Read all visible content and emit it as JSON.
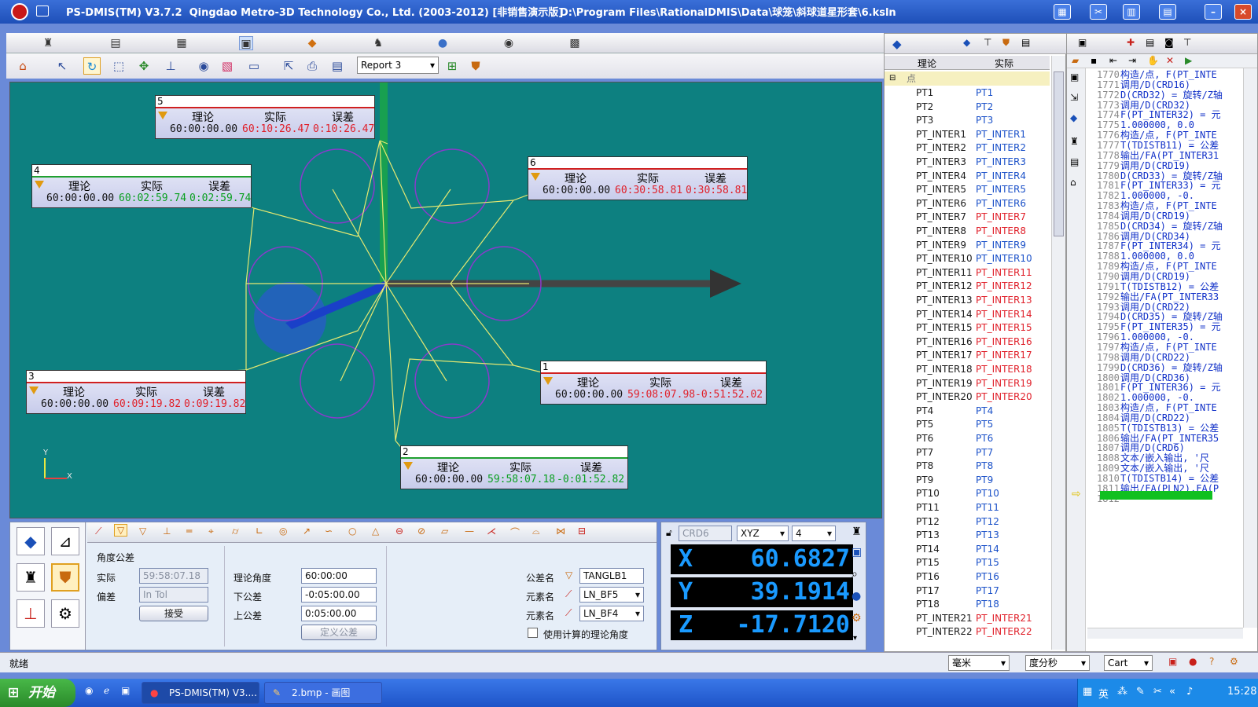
{
  "titlebar": {
    "app": "PS-DMIS(TM) V3.7.2",
    "company": "Qingdao Metro-3D Technology Co., Ltd. (2003-2012) [非销售演示版]",
    "path": "D:\\Program Files\\RationalDMIS\\Data\\球笼\\斜球道星形套\\6.ksln"
  },
  "toolbar": {
    "report": "Report 3"
  },
  "boxes": [
    {
      "id": "5",
      "h": [
        "理论",
        "实际",
        "误差"
      ],
      "theo": "60:00:00.00",
      "act": "60:10:26.47",
      "err": "0:10:26.47",
      "color": "red"
    },
    {
      "id": "4",
      "h": [
        "理论",
        "实际",
        "误差"
      ],
      "theo": "60:00:00.00",
      "act": "60:02:59.74",
      "err": "0:02:59.74",
      "color": "green"
    },
    {
      "id": "6",
      "h": [
        "理论",
        "实际",
        "误差"
      ],
      "theo": "60:00:00.00",
      "act": "60:30:58.81",
      "err": "0:30:58.81",
      "color": "red"
    },
    {
      "id": "1",
      "h": [
        "理论",
        "实际",
        "误差"
      ],
      "theo": "60:00:00.00",
      "act": "59:08:07.98",
      "err": "-0:51:52.02",
      "color": "red"
    },
    {
      "id": "3",
      "h": [
        "理论",
        "实际",
        "误差"
      ],
      "theo": "60:00:00.00",
      "act": "60:09:19.82",
      "err": "0:09:19.82",
      "color": "red"
    },
    {
      "id": "2",
      "h": [
        "理论",
        "实际",
        "误差"
      ],
      "theo": "60:00:00.00",
      "act": "59:58:07.18",
      "err": "-0:01:52.82",
      "color": "green"
    }
  ],
  "axes": {
    "y": "Y",
    "x": "X"
  },
  "tree": {
    "col1": "理论",
    "col2": "实际",
    "root": "点",
    "rows": [
      [
        "PT1",
        "PT1",
        "b"
      ],
      [
        "PT2",
        "PT2",
        "b"
      ],
      [
        "PT3",
        "PT3",
        "b"
      ],
      [
        "PT_INTER1",
        "PT_INTER1",
        "b"
      ],
      [
        "PT_INTER2",
        "PT_INTER2",
        "b"
      ],
      [
        "PT_INTER3",
        "PT_INTER3",
        "b"
      ],
      [
        "PT_INTER4",
        "PT_INTER4",
        "b"
      ],
      [
        "PT_INTER5",
        "PT_INTER5",
        "b"
      ],
      [
        "PT_INTER6",
        "PT_INTER6",
        "b"
      ],
      [
        "PT_INTER7",
        "PT_INTER7",
        "r"
      ],
      [
        "PT_INTER8",
        "PT_INTER8",
        "r"
      ],
      [
        "PT_INTER9",
        "PT_INTER9",
        "b"
      ],
      [
        "PT_INTER10",
        "PT_INTER10",
        "b"
      ],
      [
        "PT_INTER11",
        "PT_INTER11",
        "r"
      ],
      [
        "PT_INTER12",
        "PT_INTER12",
        "r"
      ],
      [
        "PT_INTER13",
        "PT_INTER13",
        "r"
      ],
      [
        "PT_INTER14",
        "PT_INTER14",
        "r"
      ],
      [
        "PT_INTER15",
        "PT_INTER15",
        "r"
      ],
      [
        "PT_INTER16",
        "PT_INTER16",
        "r"
      ],
      [
        "PT_INTER17",
        "PT_INTER17",
        "r"
      ],
      [
        "PT_INTER18",
        "PT_INTER18",
        "r"
      ],
      [
        "PT_INTER19",
        "PT_INTER19",
        "r"
      ],
      [
        "PT_INTER20",
        "PT_INTER20",
        "r"
      ],
      [
        "PT4",
        "PT4",
        "b"
      ],
      [
        "PT5",
        "PT5",
        "b"
      ],
      [
        "PT6",
        "PT6",
        "b"
      ],
      [
        "PT7",
        "PT7",
        "b"
      ],
      [
        "PT8",
        "PT8",
        "b"
      ],
      [
        "PT9",
        "PT9",
        "b"
      ],
      [
        "PT10",
        "PT10",
        "b"
      ],
      [
        "PT11",
        "PT11",
        "b"
      ],
      [
        "PT12",
        "PT12",
        "b"
      ],
      [
        "PT13",
        "PT13",
        "b"
      ],
      [
        "PT14",
        "PT14",
        "b"
      ],
      [
        "PT15",
        "PT15",
        "b"
      ],
      [
        "PT16",
        "PT16",
        "b"
      ],
      [
        "PT17",
        "PT17",
        "b"
      ],
      [
        "PT18",
        "PT18",
        "b"
      ],
      [
        "PT_INTER21",
        "PT_INTER21",
        "r"
      ],
      [
        "PT_INTER22",
        "PT_INTER22",
        "r"
      ]
    ]
  },
  "code": [
    [
      "1770",
      "构造/点, F(PT_INTE"
    ],
    [
      "1771",
      "调用/D(CRD16)"
    ],
    [
      "1772",
      "D(CRD32) = 旋转/Z轴"
    ],
    [
      "1773",
      "调用/D(CRD32)"
    ],
    [
      "1774",
      "F(PT_INTER32) = 元"
    ],
    [
      "1775",
      "    1.000000, 0.0"
    ],
    [
      "1776",
      "构造/点, F(PT_INTE"
    ],
    [
      "1777",
      "T(TDISTB11) = 公差"
    ],
    [
      "1778",
      "输出/FA(PT_INTER31"
    ],
    [
      "1779",
      "调用/D(CRD19)"
    ],
    [
      "1780",
      "D(CRD33) = 旋转/Z轴"
    ],
    [
      "1781",
      "F(PT_INTER33) = 元"
    ],
    [
      "1782",
      "    1.000000, -0."
    ],
    [
      "1783",
      "构造/点, F(PT_INTE"
    ],
    [
      "1784",
      "调用/D(CRD19)"
    ],
    [
      "1785",
      "D(CRD34) = 旋转/Z轴"
    ],
    [
      "1786",
      "调用/D(CRD34)"
    ],
    [
      "1787",
      "F(PT_INTER34) = 元"
    ],
    [
      "1788",
      "    1.000000, 0.0"
    ],
    [
      "1789",
      "构造/点, F(PT_INTE"
    ],
    [
      "1790",
      "调用/D(CRD19)"
    ],
    [
      "1791",
      "T(TDISTB12) = 公差"
    ],
    [
      "1792",
      "输出/FA(PT_INTER33"
    ],
    [
      "1793",
      "调用/D(CRD22)"
    ],
    [
      "1794",
      "D(CRD35) = 旋转/Z轴"
    ],
    [
      "1795",
      "F(PT_INTER35) = 元"
    ],
    [
      "1796",
      "    1.000000, -0."
    ],
    [
      "1797",
      "构造/点, F(PT_INTE"
    ],
    [
      "1798",
      "调用/D(CRD22)"
    ],
    [
      "1799",
      "D(CRD36) = 旋转/Z轴"
    ],
    [
      "1800",
      "调用/D(CRD36)"
    ],
    [
      "1801",
      "F(PT_INTER36) = 元"
    ],
    [
      "1802",
      "    1.000000, -0."
    ],
    [
      "1803",
      "构造/点, F(PT_INTE"
    ],
    [
      "1804",
      "调用/D(CRD22)"
    ],
    [
      "1805",
      "T(TDISTB13) = 公差"
    ],
    [
      "1806",
      "输出/FA(PT_INTER35"
    ],
    [
      "1807",
      "调用/D(CRD6)"
    ],
    [
      "1808",
      "文本/嵌入输出, '尺"
    ],
    [
      "1809",
      "文本/嵌入输出, '尺"
    ],
    [
      "1810",
      "T(TDISTB14) = 公差"
    ],
    [
      "1811",
      "输出/FA(PLN2),FA(P"
    ],
    [
      "1812",
      ""
    ]
  ],
  "panel": {
    "title": "角度公差",
    "actual_label": "实际",
    "actual": "59:58:07.18",
    "dev_label": "偏差",
    "dev": "In Tol",
    "accept": "接受",
    "theo_label": "理论角度",
    "theo": "60:00:00",
    "lower_label": "下公差",
    "lower": "-0:05:00.00",
    "upper_label": "上公差",
    "upper": "0:05:00.00",
    "define": "定义公差",
    "tolname_label": "公差名",
    "tolname": "TANGLB1",
    "elem_label": "元素名",
    "elem1": "LN_BF5",
    "elem2": "LN_BF4",
    "usecalc": "使用计算的理论角度"
  },
  "dro": {
    "crd": "CRD6",
    "mode": "XYZ",
    "digits": "4",
    "x": "60.6827",
    "y": "39.1914",
    "z": "-17.7120",
    "xl": "X",
    "yl": "Y",
    "zl": "Z"
  },
  "status": {
    "text": "就绪",
    "unit": "毫米",
    "angle": "度分秒",
    "coord": "Cart"
  },
  "taskbar": {
    "start": "开始",
    "task1": "PS-DMIS(TM) V3....",
    "task2": "2.bmp - 画图",
    "lang": "英",
    "time": "15:28"
  }
}
